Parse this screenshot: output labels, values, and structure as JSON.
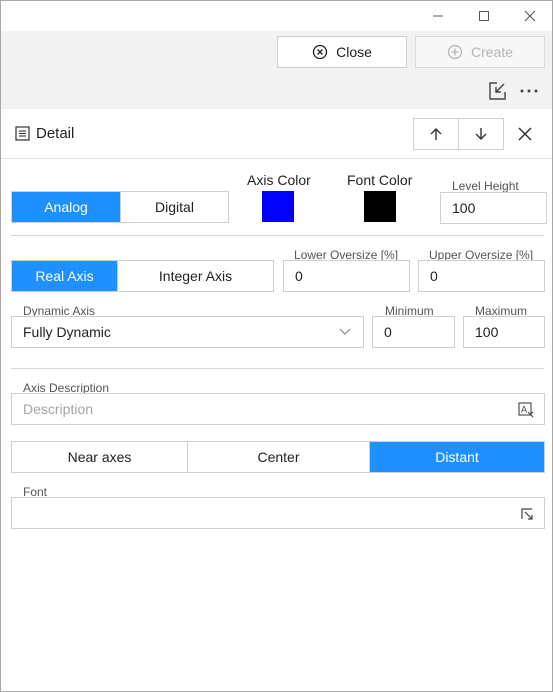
{
  "toolbar": {
    "close_label": "Close",
    "create_label": "Create"
  },
  "detail": {
    "title": "Detail"
  },
  "scale_type": {
    "options": [
      "Analog",
      "Digital"
    ],
    "selected": "Analog"
  },
  "axis_color": {
    "label": "Axis Color",
    "value": "#0000ff"
  },
  "font_color": {
    "label": "Font Color",
    "value": "#000000"
  },
  "level_height": {
    "label": "Level Height",
    "value": "100"
  },
  "axis_kind": {
    "options": [
      "Real Axis",
      "Integer Axis"
    ],
    "selected": "Real Axis"
  },
  "lower_oversize": {
    "label": "Lower Oversize [%]",
    "value": "0"
  },
  "upper_oversize": {
    "label": "Upper Oversize [%]",
    "value": "0"
  },
  "dynamic_axis": {
    "label": "Dynamic Axis",
    "value": "Fully Dynamic"
  },
  "minimum": {
    "label": "Minimum",
    "value": "0"
  },
  "maximum": {
    "label": "Maximum",
    "value": "100"
  },
  "axis_description": {
    "label": "Axis Description",
    "placeholder": "Description"
  },
  "axis_position": {
    "options": [
      "Near axes",
      "Center",
      "Distant"
    ],
    "selected": "Distant"
  },
  "font": {
    "label": "Font",
    "value": ""
  },
  "colors": {
    "accent": "#1e90ff",
    "border": "#cfcfcf"
  }
}
